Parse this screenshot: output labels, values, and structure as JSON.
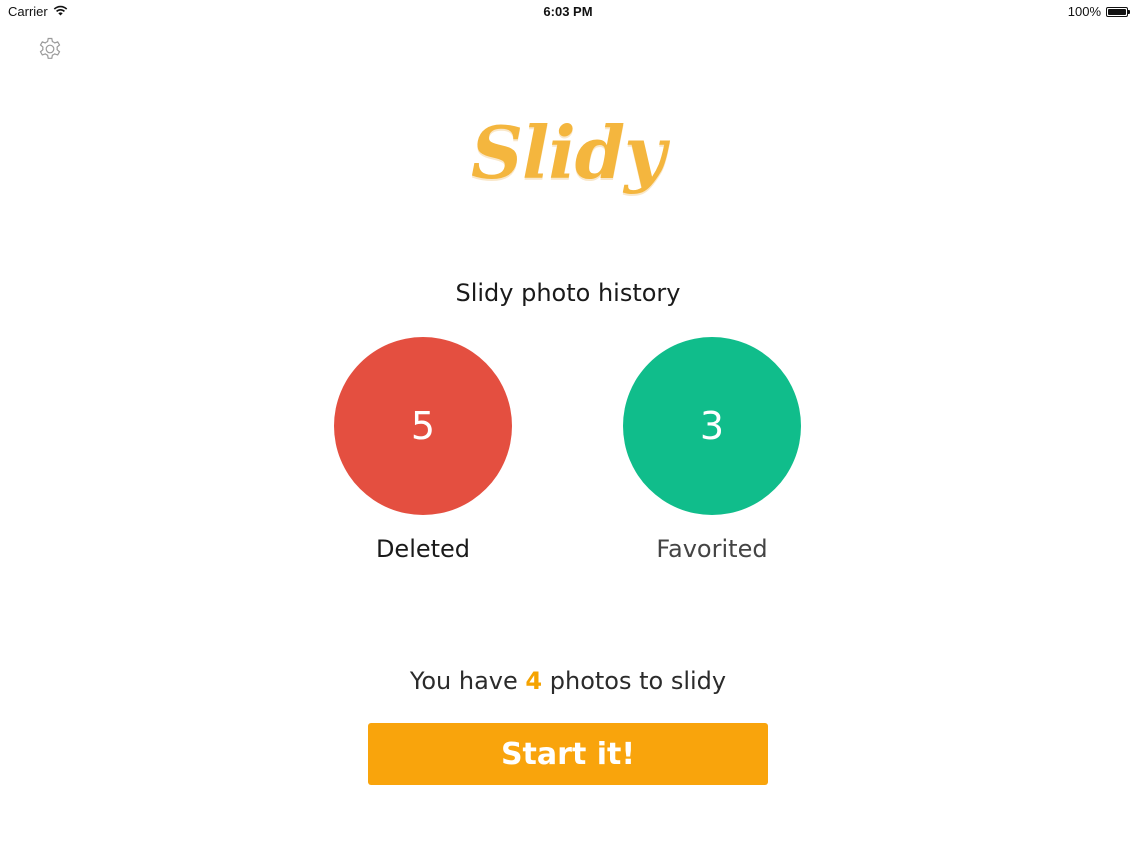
{
  "status_bar": {
    "carrier": "Carrier",
    "time": "6:03 PM",
    "battery_text": "100%",
    "battery_level": 1.0
  },
  "header": {
    "settings_icon": "gear-icon"
  },
  "logo": {
    "text": "Slidy",
    "color": "#f4b63e"
  },
  "history": {
    "title": "Slidy photo history",
    "stats": [
      {
        "count": "5",
        "label": "Deleted",
        "color": "#e44f40"
      },
      {
        "count": "3",
        "label": "Favorited",
        "color": "#10bd8b"
      }
    ]
  },
  "summary": {
    "prefix": "You have",
    "count": "4",
    "suffix": "photos to slidy",
    "count_color": "#f5a300"
  },
  "start_button": {
    "label": "Start it!",
    "color": "#f9a40c"
  }
}
